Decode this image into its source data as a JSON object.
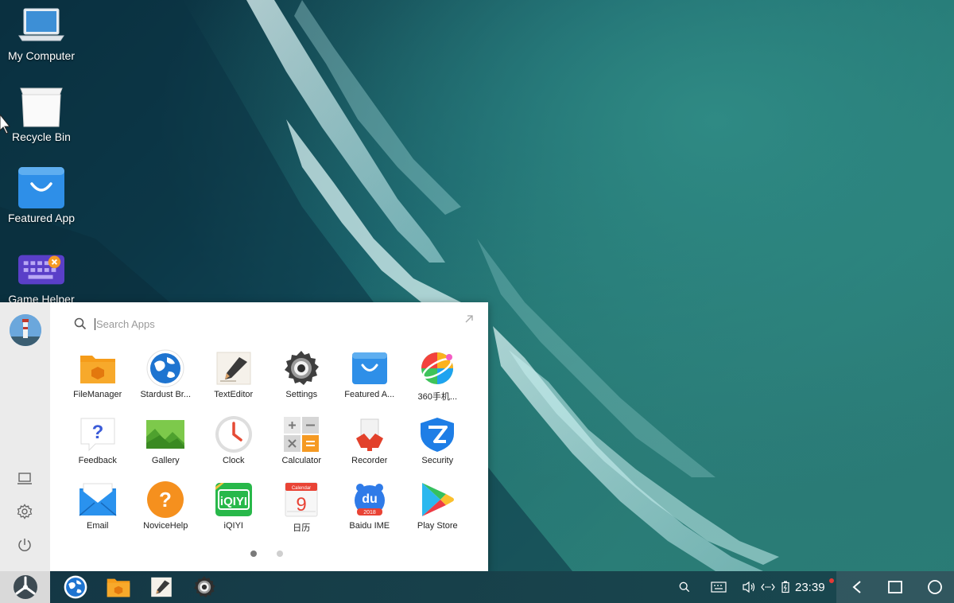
{
  "desktop": {
    "icons": [
      {
        "label": "My Computer",
        "icon": "laptop-icon"
      },
      {
        "label": "Recycle Bin",
        "icon": "recycle-bin-icon"
      },
      {
        "label": "Featured App",
        "icon": "shopping-bag-icon"
      },
      {
        "label": "Game Helper",
        "icon": "keyboard-icon"
      }
    ]
  },
  "start_menu": {
    "search": {
      "placeholder": "Search Apps"
    },
    "apps": [
      {
        "label": "FileManager",
        "icon": "folder-icon"
      },
      {
        "label": "Stardust Br...",
        "icon": "browser-globe-icon"
      },
      {
        "label": "TextEditor",
        "icon": "text-editor-icon"
      },
      {
        "label": "Settings",
        "icon": "gear-icon"
      },
      {
        "label": "Featured A...",
        "icon": "shopping-bag-icon"
      },
      {
        "label": "360手机...",
        "icon": "colorful-ball-icon"
      },
      {
        "label": "Feedback",
        "icon": "question-bubble-icon"
      },
      {
        "label": "Gallery",
        "icon": "image-icon"
      },
      {
        "label": "Clock",
        "icon": "clock-icon"
      },
      {
        "label": "Calculator",
        "icon": "calculator-icon"
      },
      {
        "label": "Recorder",
        "icon": "recorder-icon"
      },
      {
        "label": "Security",
        "icon": "shield-icon"
      },
      {
        "label": "Email",
        "icon": "envelope-icon"
      },
      {
        "label": "NoviceHelp",
        "icon": "help-circle-icon"
      },
      {
        "label": "iQIYI",
        "icon": "iqiyi-icon"
      },
      {
        "label": "日历",
        "icon": "calendar-icon"
      },
      {
        "label": "Baidu IME",
        "icon": "baidu-ime-icon"
      },
      {
        "label": "Play Store",
        "icon": "play-store-icon"
      }
    ],
    "calendar_day": "9",
    "calendar_header": "Calendar",
    "baidu_badge": "du",
    "baidu_year": "2018",
    "iqiyi_text": "iQIYI",
    "pager": {
      "pages": 2,
      "current": 1
    },
    "sidebar": [
      "laptop-icon",
      "gear-icon",
      "power-icon"
    ]
  },
  "taskbar": {
    "pinned": [
      "browser-globe-icon",
      "folder-icon",
      "text-editor-icon",
      "gear-icon"
    ],
    "tray": [
      "search-icon",
      "keyboard-icon",
      "volume-icon",
      "network-icon",
      "battery-icon"
    ],
    "clock": "23:39",
    "nav": [
      "back-icon",
      "recents-icon",
      "home-icon"
    ]
  },
  "colors": {
    "accent_blue": "#2e8fe8",
    "taskbar": "#153b46",
    "notification": "#e53935"
  }
}
